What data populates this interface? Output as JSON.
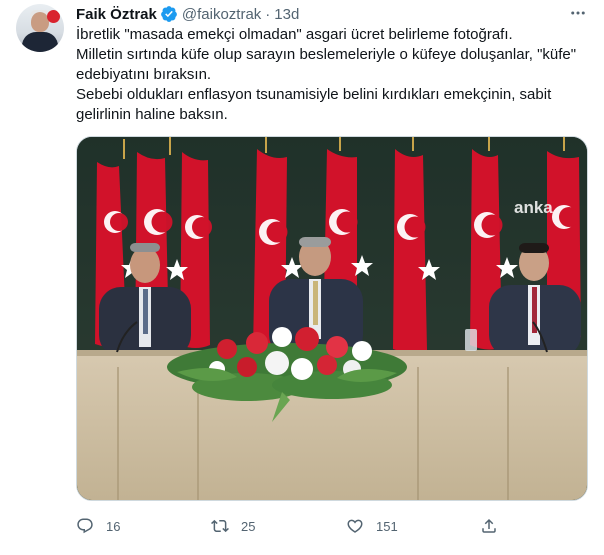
{
  "tweet": {
    "author": "Faik Öztrak",
    "handle": "@faikoztrak",
    "separator": "·",
    "time": "13d",
    "lines": [
      "İbretlik \"masada emekçi olmadan\" asgari ücret belirleme fotoğrafı.",
      "Milletin sırtında küfe olup sarayın beslemeleriyle o küfeye doluşanlar, \"küfe\"",
      "edebiyatını bıraksın.",
      "Sebebi oldukları enflasyon tsunamisiyle belini kırdıkları emekçinin, sabit",
      "gelirlinin haline baksın."
    ],
    "media": {
      "watermark": "anka"
    },
    "stats": {
      "replies": "16",
      "retweets": "25",
      "likes": "151"
    }
  },
  "colors": {
    "text": "#0f1419",
    "secondary": "#536471",
    "verified": "#1d9bf0",
    "flag_red": "#d1122a"
  },
  "icons": [
    "verified-badge-icon",
    "more-icon",
    "reply-icon",
    "retweet-icon",
    "like-icon",
    "share-icon"
  ]
}
